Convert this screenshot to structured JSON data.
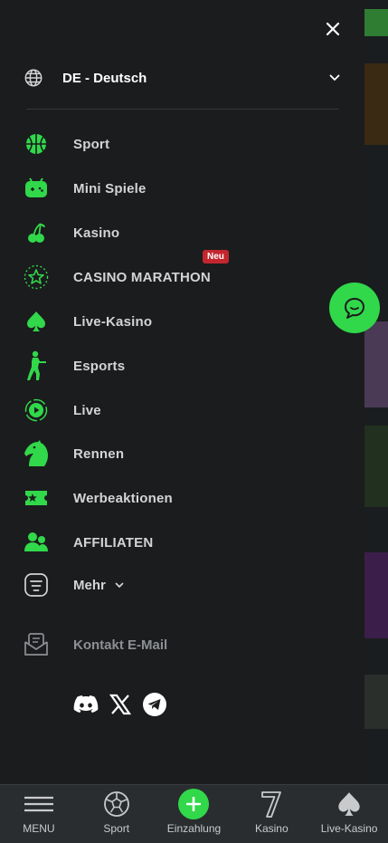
{
  "colors": {
    "accent": "#31d84a",
    "badge": "#c4262e",
    "drawer_bg": "#1b1c1e",
    "text": "#d2d4d6"
  },
  "language": {
    "label": "DE - Deutsch"
  },
  "nav": [
    {
      "label": "Sport",
      "icon": "basketball-icon"
    },
    {
      "label": "Mini Spiele",
      "icon": "gamepad-icon"
    },
    {
      "label": "Kasino",
      "icon": "cherry-icon"
    },
    {
      "label": "CASINO MARATHON",
      "icon": "star-icon",
      "badge": "Neu"
    },
    {
      "label": "Live-Kasino",
      "icon": "spade-icon"
    },
    {
      "label": "Esports",
      "icon": "soldier-icon"
    },
    {
      "label": "Live",
      "icon": "live-play-icon"
    },
    {
      "label": "Rennen",
      "icon": "horse-icon"
    },
    {
      "label": "Werbeaktionen",
      "icon": "promo-ticket-icon"
    },
    {
      "label": "AFFILIATEN",
      "icon": "users-icon"
    }
  ],
  "more": {
    "label": "Mehr"
  },
  "contact": {
    "label": "Kontakt E-Mail"
  },
  "socials": [
    "discord-icon",
    "x-icon",
    "telegram-icon"
  ],
  "bottom_bar": [
    {
      "label": "MENU",
      "icon": "hamburger-icon"
    },
    {
      "label": "Sport",
      "icon": "soccer-ball-icon"
    },
    {
      "label": "Einzahlung",
      "icon": "plus-icon"
    },
    {
      "label": "Kasino",
      "icon": "seven-icon"
    },
    {
      "label": "Live-Kasino",
      "icon": "spade-icon"
    }
  ]
}
